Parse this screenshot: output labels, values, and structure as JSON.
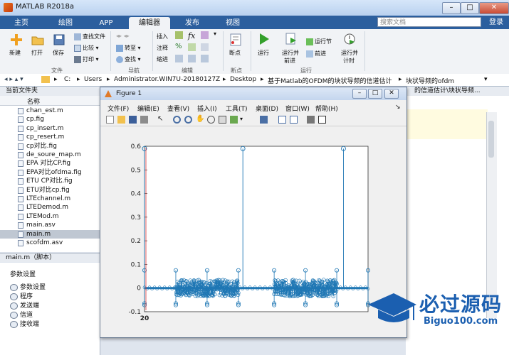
{
  "window": {
    "title": "MATLAB R2018a",
    "minimize": "–",
    "maximize": "□",
    "close": "✕"
  },
  "tabs": [
    {
      "label": "主页"
    },
    {
      "label": "绘图"
    },
    {
      "label": "APP"
    },
    {
      "label": "编辑器"
    },
    {
      "label": "发布"
    },
    {
      "label": "视图"
    }
  ],
  "search": {
    "placeholder": "搜索文档"
  },
  "login": "登录",
  "ribbon": {
    "file": {
      "new": "新建",
      "open": "打开",
      "save": "保存",
      "find_files": "查找文件",
      "compare": "比较",
      "print": "打印",
      "group": "文件"
    },
    "nav": {
      "goto": "转至",
      "find": "查找",
      "group": "导航"
    },
    "edit": {
      "insert": "插入",
      "fx": "fx",
      "comment": "注释",
      "indent": "缩进",
      "percent": "%",
      "group": "编辑"
    },
    "breakpoints": {
      "label": "断点",
      "group": "断点"
    },
    "run": {
      "run": "运行",
      "run_advance_1": "运行并",
      "run_advance_2": "前进",
      "run_section": "运行节",
      "advance": "前进",
      "run_time_1": "运行并",
      "run_time_2": "计时",
      "group": "运行"
    }
  },
  "address": {
    "parts": [
      "C:",
      "Users",
      "Administrator.WIN7U-20180127Z",
      "Desktop",
      "基于Matlab的OFDM的块状导频的信道估计",
      "块状导频的ofdm"
    ]
  },
  "left": {
    "current_folder": "当前文件夹",
    "name_col": "名称",
    "files": [
      "chan_est.m",
      "cp.fig",
      "cp_insert.m",
      "cp_resert.m",
      "cp对比.fig",
      "de_soure_map.m",
      "EPA 对比CP.fig",
      "EPA对比ofdma.fig",
      "ETU CP对比.fig",
      "ETU对比cp.fig",
      "LTEchannel.m",
      "LTEDemod.m",
      "LTEMod.m",
      "main.asv",
      "main.m",
      "scofdm.asv"
    ],
    "selected": "main.m",
    "detail_header": "main.m（脚本）",
    "detail_title": "参数设置",
    "sections": [
      "参数设置",
      "程序",
      "发送端",
      "信道",
      "接收端"
    ]
  },
  "editor": {
    "tab_text": "的信道估计\\块状导频..."
  },
  "figure": {
    "title": "Figure 1",
    "menu": [
      "文件(F)",
      "编辑(E)",
      "查看(V)",
      "插入(I)",
      "工具(T)",
      "桌面(D)",
      "窗口(W)",
      "帮助(H)"
    ]
  },
  "chart_data": {
    "type": "scatter",
    "title": "",
    "xlabel": "",
    "ylabel": "",
    "ylim": [
      -0.1,
      0.6
    ],
    "yticks": [
      "0.6",
      "0.5",
      "0.4",
      "0.3",
      "0.2",
      "0.1",
      "0",
      "-0.1"
    ],
    "xtick_label": "20",
    "color": "#1f77b4",
    "series": [
      {
        "kind": "pilot_spikes",
        "x_frac": [
          0.0,
          0.44,
          0.89
        ],
        "values": [
          0.59,
          0.59,
          0.59
        ]
      },
      {
        "kind": "edge_markers",
        "x_frac": [
          0.0,
          0.14,
          0.28,
          0.42,
          0.58,
          0.72,
          0.86,
          1.0
        ],
        "values": [
          0.075,
          -0.065
        ]
      },
      {
        "kind": "dense_bands",
        "x_frac": [
          [
            0.14,
            0.42
          ],
          [
            0.58,
            0.86
          ]
        ],
        "amplitude": 0.035
      }
    ]
  },
  "watermark": {
    "main": "必过源码",
    "sub": "Biguo100.com"
  }
}
